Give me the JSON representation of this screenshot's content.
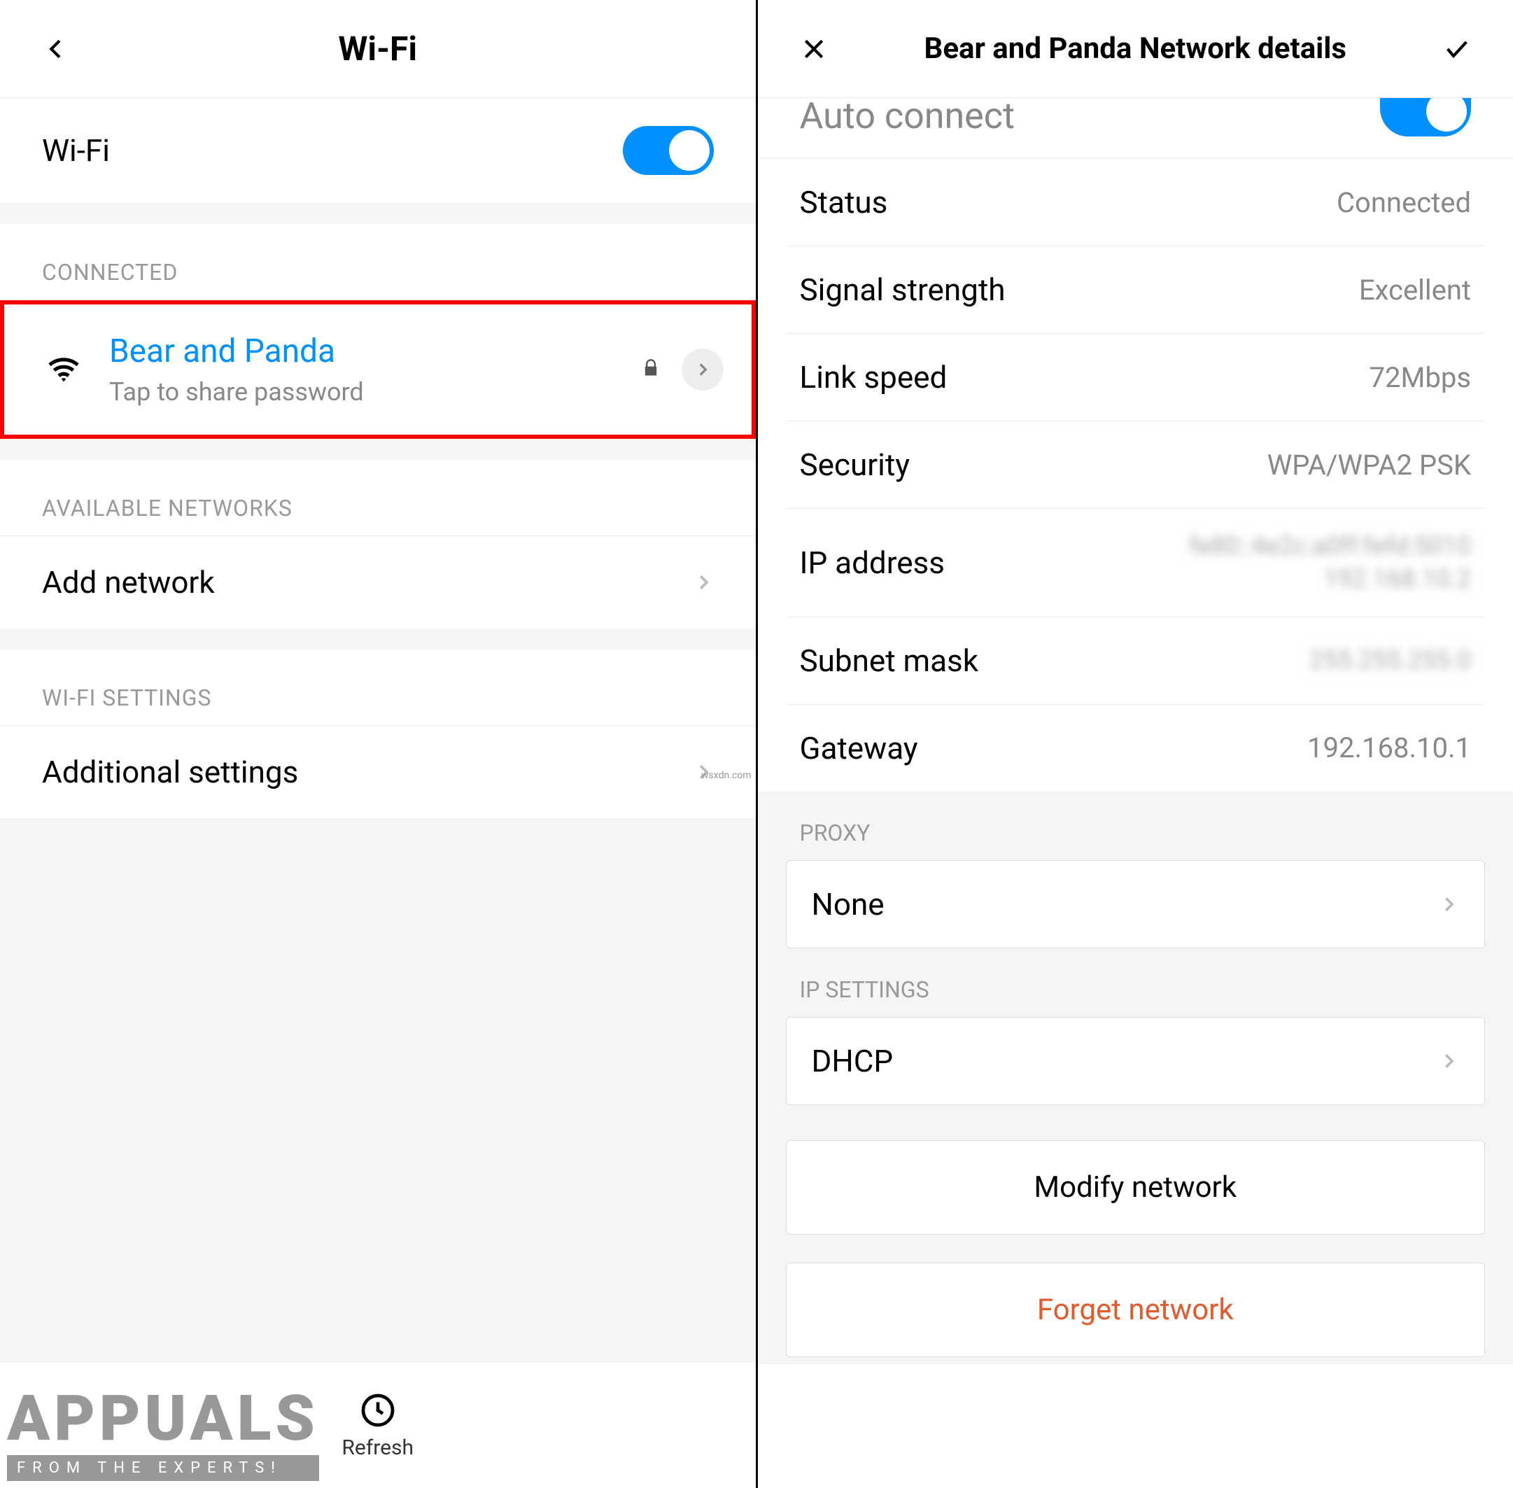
{
  "left": {
    "header_title": "Wi-Fi",
    "wifi_toggle_label": "Wi-Fi",
    "section_connected": "CONNECTED",
    "network_name": "Bear and Panda",
    "network_sub": "Tap to share password",
    "section_available": "AVAILABLE NETWORKS",
    "add_network": "Add network",
    "section_wifi_settings": "WI-FI SETTINGS",
    "additional_settings": "Additional settings",
    "refresh_label": "Refresh",
    "watermark_main": "APPUALS",
    "watermark_sub": "FROM THE EXPERTS!"
  },
  "right": {
    "header_title": "Bear and Panda Network details",
    "auto_connect": "Auto connect",
    "rows": {
      "status_label": "Status",
      "status_value": "Connected",
      "signal_label": "Signal strength",
      "signal_value": "Excellent",
      "speed_label": "Link speed",
      "speed_value": "72Mbps",
      "security_label": "Security",
      "security_value": "WPA/WPA2 PSK",
      "ip_label": "IP address",
      "ip_value_blur1": "fe80::4e2c:a0ff:fefd:5010",
      "ip_value_blur2": "192.168.10.2",
      "subnet_label": "Subnet mask",
      "subnet_value_blur": "255.255.255.0",
      "gateway_label": "Gateway",
      "gateway_value": "192.168.10.1"
    },
    "proxy_header": "PROXY",
    "proxy_value": "None",
    "ip_settings_header": "IP SETTINGS",
    "ip_settings_value": "DHCP",
    "modify_button": "Modify network",
    "forget_button": "Forget network",
    "wsx": "wsxdn.com"
  }
}
